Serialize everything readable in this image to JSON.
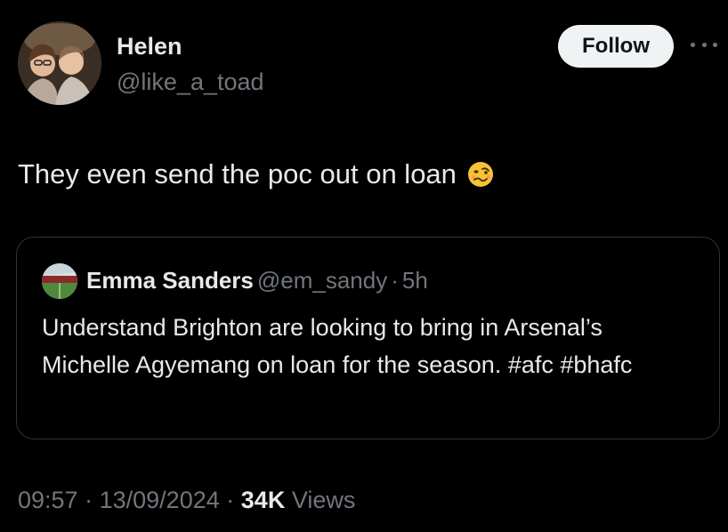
{
  "author": {
    "display_name": "Helen",
    "handle": "@like_a_toad",
    "avatar_icon": "profile-photo"
  },
  "follow_button": {
    "label": "Follow"
  },
  "more_menu": {
    "icon": "more-horizontal-icon"
  },
  "tweet": {
    "text": "They even send the poc out on loan",
    "emoji": "woozy-face"
  },
  "quote": {
    "display_name": "Emma Sanders",
    "handle": "@em_sandy",
    "separator": "·",
    "time": "5h",
    "text": "Understand Brighton are looking to bring in Arsenal’s Michelle Agyemang on loan for the season. #afc #bhafc"
  },
  "footer": {
    "time": "09:57",
    "sep1": "·",
    "date": "13/09/2024",
    "sep2": "·",
    "views_count": "34K",
    "views_label": "Views"
  },
  "colors": {
    "background": "#000000",
    "primary_text": "#e7e9ea",
    "secondary_text": "#71767b",
    "follow_bg": "#eff3f4",
    "border": "#2f3336"
  }
}
